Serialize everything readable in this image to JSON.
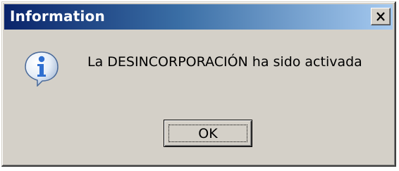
{
  "window": {
    "title": "Information",
    "close_icon": "close-icon"
  },
  "body": {
    "icon": "information-icon",
    "message": "La DESINCORPORACIÓN ha sido activada"
  },
  "buttons": {
    "ok_label": "OK"
  },
  "colors": {
    "titlebar_start": "#0a246a",
    "titlebar_end": "#a6caf0",
    "dialog_face": "#d4d0c8",
    "icon_blue": "#2f6fd0"
  }
}
